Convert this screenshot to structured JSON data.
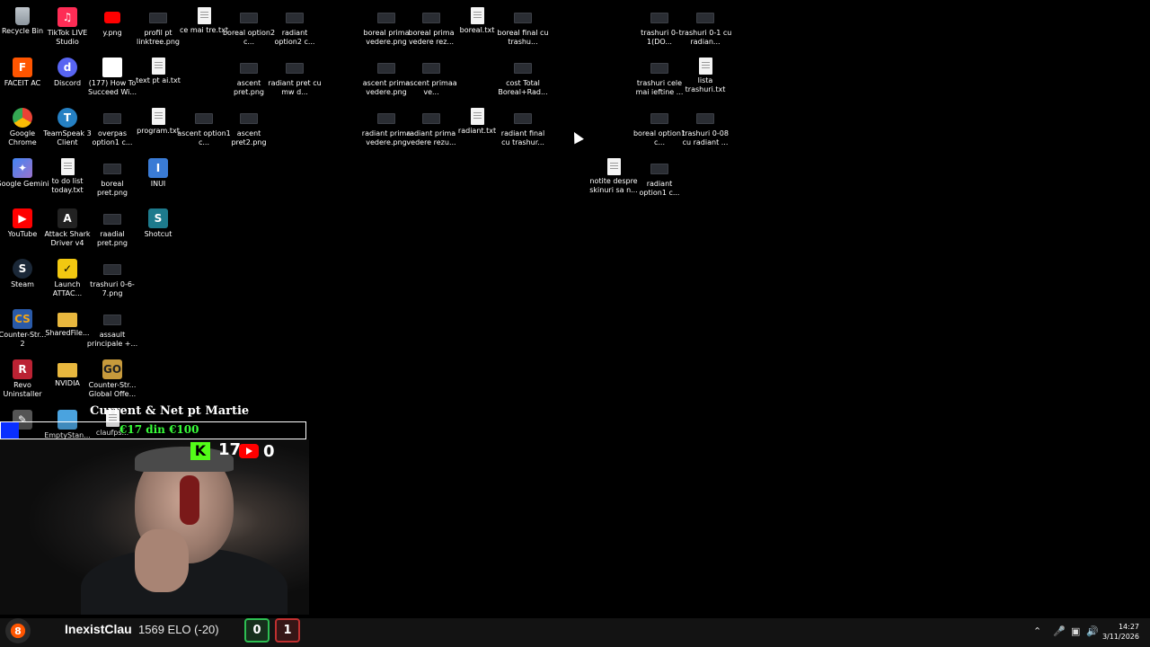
{
  "desktop": {
    "icons": [
      {
        "label": "Recycle Bin",
        "icon": "recycle-bin-icon"
      },
      {
        "label": "TikTok LIVE Studio",
        "icon": "tiktok-live-studio-icon"
      },
      {
        "label": "y.png",
        "icon": "youtube-image-icon"
      },
      {
        "label": "profil pt linktree.png",
        "icon": "image-icon"
      },
      {
        "label": "ce mai tre.txt",
        "icon": "text-file-icon"
      },
      {
        "label": "boreal option2 c...",
        "icon": "image-icon"
      },
      {
        "label": "radiant option2 c...",
        "icon": "image-icon"
      },
      {
        "label": "boreal prima vedere.png",
        "icon": "image-icon"
      },
      {
        "label": "boreal prima vedere rez...",
        "icon": "image-icon"
      },
      {
        "label": "boreal.txt",
        "icon": "text-file-icon"
      },
      {
        "label": "boreal final cu trashu...",
        "icon": "image-icon"
      },
      {
        "label": "trashuri 0-1(DO...",
        "icon": "image-icon"
      },
      {
        "label": "trashuri 0-1 cu radian...",
        "icon": "image-icon"
      },
      {
        "label": "FACEIT AC",
        "icon": "faceit-ac-icon"
      },
      {
        "label": "Discord",
        "icon": "discord-icon"
      },
      {
        "label": "(177) How To Succeed Wi...",
        "icon": "chrome-shortcut-icon"
      },
      {
        "label": "text pt ai.txt",
        "icon": "text-file-icon"
      },
      {
        "label": "ascent pret.png",
        "icon": "image-icon"
      },
      {
        "label": "radiant pret cu mw d...",
        "icon": "image-icon"
      },
      {
        "label": "ascent prima vedere.png",
        "icon": "image-icon"
      },
      {
        "label": "ascent primaa ve...",
        "icon": "image-icon"
      },
      {
        "label": "cost Total Boreal+Rad...",
        "icon": "image-icon"
      },
      {
        "label": "trashuri cele mai ieftine ...",
        "icon": "image-icon"
      },
      {
        "label": "lista trashuri.txt",
        "icon": "text-file-icon"
      },
      {
        "label": "Google Chrome",
        "icon": "chrome-icon"
      },
      {
        "label": "TeamSpeak 3 Client",
        "icon": "teamspeak-icon"
      },
      {
        "label": "overpas option1 c...",
        "icon": "image-icon"
      },
      {
        "label": "program.txt",
        "icon": "text-file-icon"
      },
      {
        "label": "ascent option1 c...",
        "icon": "image-icon"
      },
      {
        "label": "ascent pret2.png",
        "icon": "image-icon"
      },
      {
        "label": "radiant prima vedere.png",
        "icon": "image-icon"
      },
      {
        "label": "radiant prima vedere rezu...",
        "icon": "image-icon"
      },
      {
        "label": "radiant.txt",
        "icon": "text-file-icon"
      },
      {
        "label": "radiant final cu trashur...",
        "icon": "image-icon"
      },
      {
        "label": "boreal option1 c...",
        "icon": "image-icon"
      },
      {
        "label": "trashuri 0-08 cu radiant ...",
        "icon": "image-icon"
      },
      {
        "label": "Google Gemini",
        "icon": "gemini-icon"
      },
      {
        "label": "to do list today.txt",
        "icon": "text-file-icon"
      },
      {
        "label": "boreal pret.png",
        "icon": "image-icon"
      },
      {
        "label": "INUI",
        "icon": "inui-icon"
      },
      {
        "label": "notite despre skinuri sa n...",
        "icon": "text-file-icon"
      },
      {
        "label": "radiant option1 c...",
        "icon": "image-icon"
      },
      {
        "label": "YouTube",
        "icon": "youtube-icon"
      },
      {
        "label": "Attack Shark Driver v4",
        "icon": "attack-shark-icon"
      },
      {
        "label": "raadial pret.png",
        "icon": "image-icon"
      },
      {
        "label": "Shotcut",
        "icon": "shotcut-icon"
      },
      {
        "label": "Steam",
        "icon": "steam-icon"
      },
      {
        "label": "Launch ATTAC...",
        "icon": "launch-attack-icon"
      },
      {
        "label": "trashuri 0-6-7.png",
        "icon": "image-icon"
      },
      {
        "label": "Counter-Str... 2",
        "icon": "counter-strike-2-icon"
      },
      {
        "label": "SharedFile...",
        "icon": "folder-icon"
      },
      {
        "label": "assault principale +...",
        "icon": "image-icon"
      },
      {
        "label": "Revo Uninstaller",
        "icon": "revo-uninstaller-icon"
      },
      {
        "label": "NVIDIA",
        "icon": "folder-icon"
      },
      {
        "label": "Counter-Str... Global Offe...",
        "icon": "csgo-icon"
      },
      {
        "label": "",
        "icon": "pen-tool-icon"
      },
      {
        "label": "EmptyStan...",
        "icon": "app-icon"
      },
      {
        "label": "claufps...",
        "icon": "text-file-icon"
      }
    ]
  },
  "overlay": {
    "title": "Current & Net pt Martie",
    "progress_text": "€17 din €100",
    "progress_fraction": 0.17,
    "kick_count": "17",
    "youtube_count": "0"
  },
  "taskbar": {
    "faceit_level": "8",
    "player_name": "InexistClau",
    "player_elo": "1569 ELO (-20)",
    "wins": "0",
    "losses": "1",
    "time": "14:27",
    "date": "3/11/2026"
  },
  "colors": {
    "kick_green": "#53fc18",
    "youtube_red": "#ff0000",
    "progress_blue": "#0a2fff",
    "progress_text": "#38ff3a",
    "win_green": "#2dbf52",
    "loss_red": "#c03030"
  }
}
